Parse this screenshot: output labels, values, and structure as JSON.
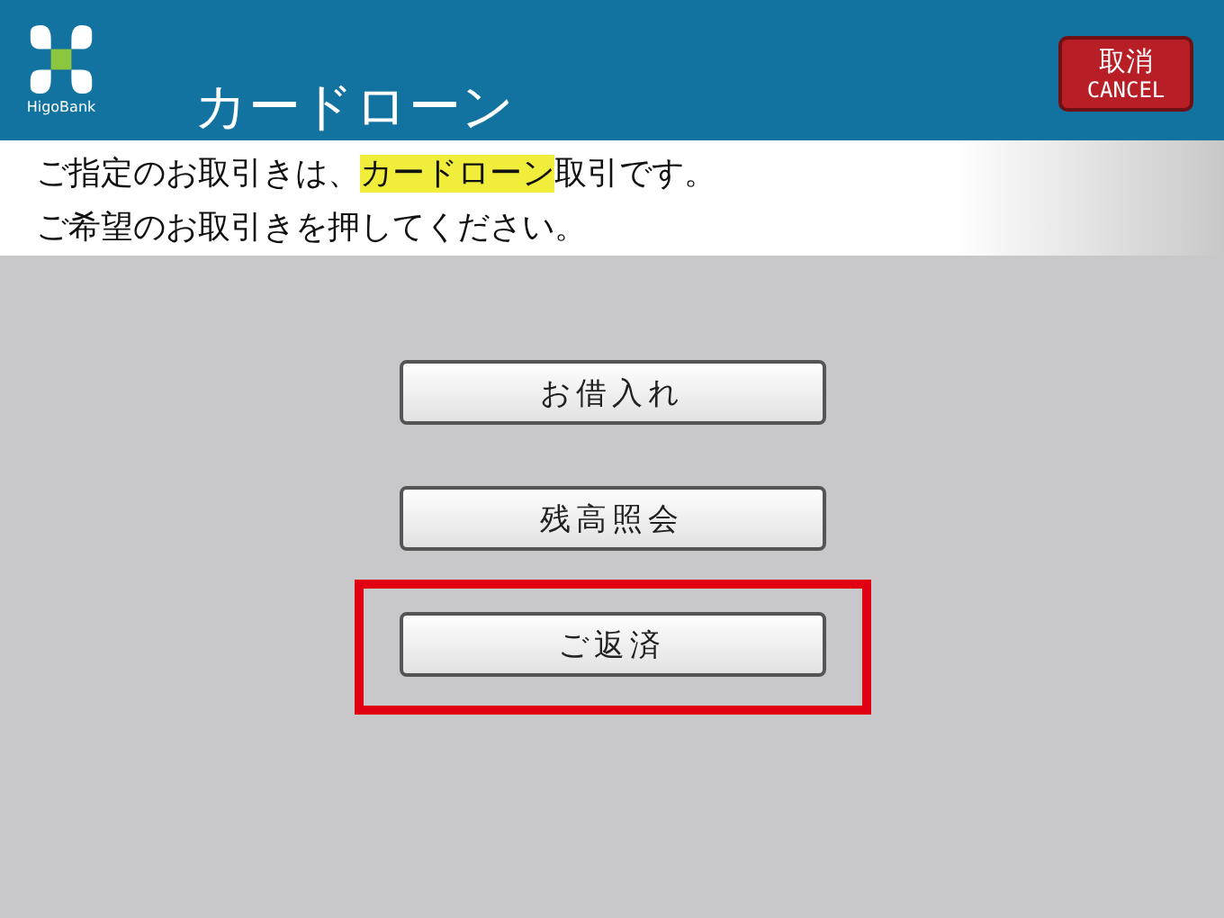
{
  "header": {
    "logo_text": "HigoBank",
    "title": "カードローン",
    "cancel_button": {
      "label": "取消",
      "sublabel": "CANCEL"
    }
  },
  "message": {
    "lines": [
      {
        "parts": [
          {
            "text": "ご指定のお取引きは、",
            "highlighted": false
          },
          {
            "text": "カードローン",
            "highlighted": true
          },
          {
            "text": "取引です。",
            "highlighted": false
          }
        ]
      },
      {
        "parts": [
          {
            "text": "ご希望のお取引きを押してください。",
            "highlighted": false
          }
        ]
      }
    ]
  },
  "options": [
    {
      "label": "お借入れ",
      "highlighted": false
    },
    {
      "label": "残高照会",
      "highlighted": false
    },
    {
      "label": "ご返済",
      "highlighted": true
    }
  ]
}
